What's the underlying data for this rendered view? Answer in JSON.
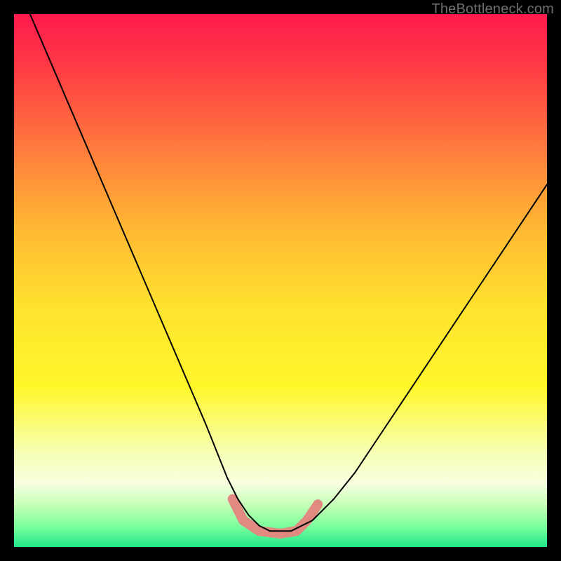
{
  "watermark": "TheBottleneck.com",
  "chart_data": {
    "type": "line",
    "title": "",
    "xlabel": "",
    "ylabel": "",
    "xlim": [
      0,
      100
    ],
    "ylim": [
      0,
      100
    ],
    "grid": false,
    "legend": false,
    "background": {
      "type": "vertical-gradient",
      "stops": [
        {
          "pos": 0.0,
          "color": "#ff1a4d"
        },
        {
          "pos": 0.1,
          "color": "#ff3b44"
        },
        {
          "pos": 0.25,
          "color": "#ff7a3c"
        },
        {
          "pos": 0.4,
          "color": "#ffb733"
        },
        {
          "pos": 0.55,
          "color": "#ffe22e"
        },
        {
          "pos": 0.7,
          "color": "#fff72a"
        },
        {
          "pos": 0.82,
          "color": "#f6ffb0"
        },
        {
          "pos": 0.88,
          "color": "#f8ffe0"
        },
        {
          "pos": 0.92,
          "color": "#c8ffb8"
        },
        {
          "pos": 0.96,
          "color": "#7cff9c"
        },
        {
          "pos": 1.0,
          "color": "#22e88a"
        }
      ]
    },
    "series": [
      {
        "name": "bottleneck-curve",
        "stroke": "#000000",
        "stroke_width": 2,
        "x": [
          3,
          6,
          9,
          12,
          15,
          18,
          21,
          24,
          27,
          30,
          33,
          36,
          38,
          40,
          42,
          44,
          46,
          48,
          50,
          52,
          56,
          60,
          64,
          68,
          72,
          76,
          80,
          84,
          88,
          92,
          96,
          100
        ],
        "y": [
          100,
          93,
          86,
          79,
          72,
          65,
          58,
          51,
          44,
          37,
          30,
          23,
          18,
          13,
          9,
          6,
          4,
          3,
          3,
          3,
          5,
          9,
          14,
          20,
          26,
          32,
          38,
          44,
          50,
          56,
          62,
          68
        ]
      }
    ],
    "markers": [
      {
        "name": "optimum-band",
        "shape": "rounded-segment",
        "color": "#e08a82",
        "width": 14,
        "points": [
          {
            "x": 41,
            "y": 9
          },
          {
            "x": 43,
            "y": 5
          },
          {
            "x": 46,
            "y": 3
          },
          {
            "x": 50,
            "y": 2.5
          },
          {
            "x": 53,
            "y": 3
          },
          {
            "x": 55,
            "y": 5
          },
          {
            "x": 57,
            "y": 8
          }
        ]
      }
    ]
  }
}
